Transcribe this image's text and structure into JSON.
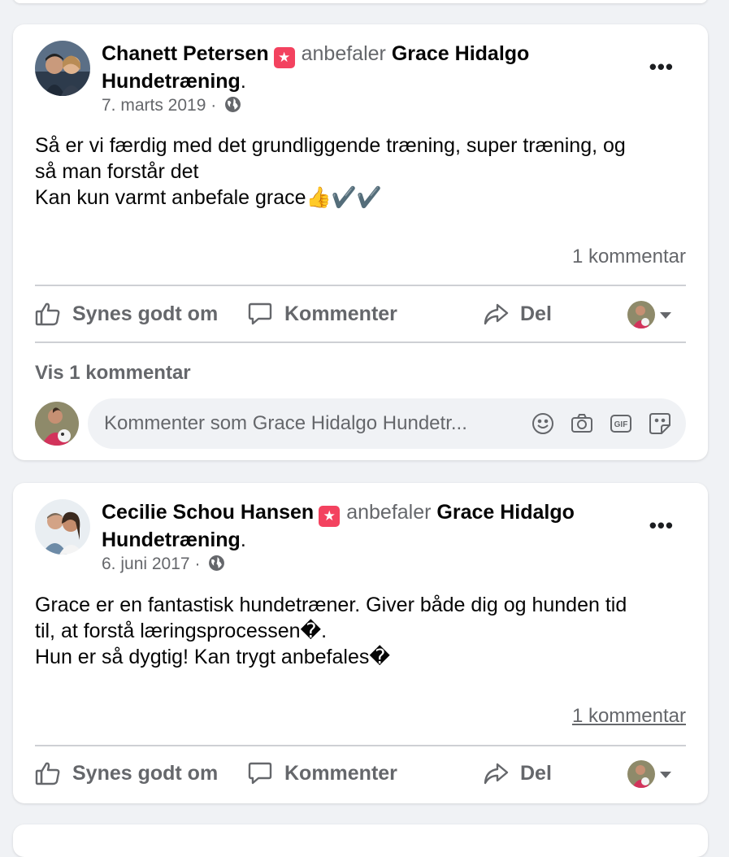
{
  "posts": [
    {
      "author": "Chanett Petersen",
      "verb": "anbefaler",
      "page_line1": "Grace Hidalgo",
      "page_line2": "Hundetræning",
      "period": ".",
      "date": "7. marts 2019",
      "separator": "·",
      "body_lines": [
        "Så er vi færdig med det grundliggende træning, super træning, og",
        "så man forstår det",
        "Kan kun varmt anbefale grace👍✔️✔️"
      ],
      "comments": "1 kommentar",
      "view_comments": "Vis 1 kommentar",
      "composer_placeholder": "Kommenter som Grace Hidalgo Hundetr..."
    },
    {
      "author": "Cecilie Schou Hansen",
      "verb": "anbefaler",
      "page_line1": "Grace Hidalgo",
      "page_line2": "Hundetræning",
      "period": ".",
      "date": "6. juni 2017",
      "separator": "·",
      "body_lines": [
        "Grace er en fantastisk hundetræner. Giver både dig og hunden tid",
        "til, at forstå læringsprocessen�.",
        "Hun er så dygtig! Kan trygt anbefales�"
      ],
      "comments": "1 kommentar"
    }
  ],
  "actions": {
    "like": "Synes godt om",
    "comment": "Kommenter",
    "share": "Del"
  },
  "icons": {
    "recommend": "recommend-star-icon",
    "audience": "globe-icon",
    "more": "more-options-icon"
  },
  "colors": {
    "recommend_badge": "#f3425f",
    "secondary_text": "#65676b",
    "background": "#f0f2f5"
  }
}
